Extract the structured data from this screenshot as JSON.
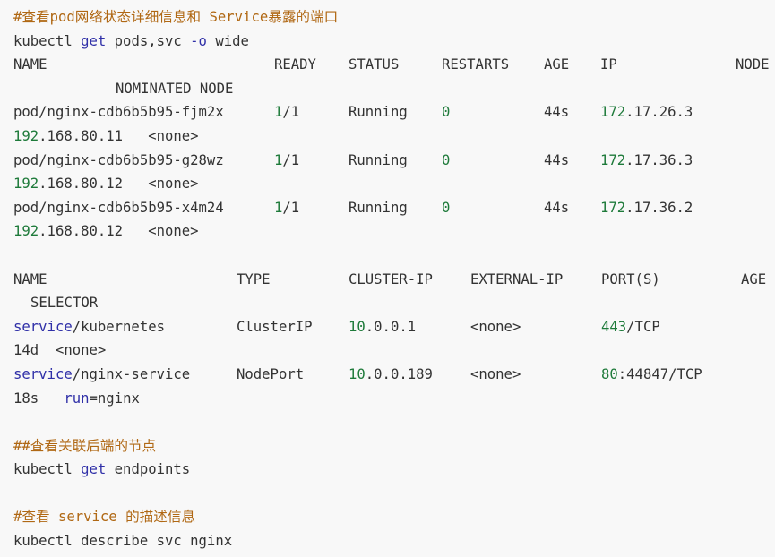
{
  "comment1": {
    "hash": "#",
    "pre": "查看",
    "pod": "pod",
    "mid": "网络状态详细信息和 ",
    "svc": "Service",
    "post": "暴露的端口"
  },
  "cmd1": {
    "a": "kubectl ",
    "get": "get",
    "b": " pods,svc ",
    "flag": "-o",
    "c": " wide"
  },
  "pods_header": {
    "name": "NAME",
    "ready": "READY",
    "status": "STATUS",
    "restarts": "RESTARTS",
    "age": "AGE",
    "ip": "IP",
    "node": "NODE",
    "nominated": "NOMINATED NODE"
  },
  "pods": [
    {
      "name": "pod/nginx-cdb6b5b95-fjm2x",
      "ready_num": "1",
      "ready_den": "/1",
      "status": "Running",
      "restarts": "0",
      "age": "44s",
      "ip_first": "172",
      "ip_rest": ".17.26.3",
      "node_first": "192",
      "node_rest": ".168.80.11",
      "nominated": "<none>"
    },
    {
      "name": "pod/nginx-cdb6b5b95-g28wz",
      "ready_num": "1",
      "ready_den": "/1",
      "status": "Running",
      "restarts": "0",
      "age": "44s",
      "ip_first": "172",
      "ip_rest": ".17.36.3",
      "node_first": "192",
      "node_rest": ".168.80.12",
      "nominated": "<none>"
    },
    {
      "name": "pod/nginx-cdb6b5b95-x4m24",
      "ready_num": "1",
      "ready_den": "/1",
      "status": "Running",
      "restarts": "0",
      "age": "44s",
      "ip_first": "172",
      "ip_rest": ".17.36.2",
      "node_first": "192",
      "node_rest": ".168.80.12",
      "nominated": "<none>"
    }
  ],
  "svc_header": {
    "name": "NAME",
    "type": "TYPE",
    "cluster_ip": "CLUSTER-IP",
    "external_ip": "EXTERNAL-IP",
    "ports": "PORT(S)",
    "age": "AGE",
    "selector": "SELECTOR"
  },
  "services": [
    {
      "kind": "service",
      "rest": "/kubernetes",
      "type": "ClusterIP",
      "cip_first": "10",
      "cip_rest": ".0.0.1",
      "external": "<none>",
      "port_num": "443",
      "port_rest": "/TCP",
      "age": "14d",
      "selector_pre": "<none>",
      "selector_key": "",
      "selector_val": ""
    },
    {
      "kind": "service",
      "rest": "/nginx-service",
      "type": "NodePort",
      "cip_first": "10",
      "cip_rest": ".0.0.189",
      "external": "<none>",
      "port_num": "80",
      "port_rest": ":44847/TCP",
      "age": "18s",
      "selector_pre": "",
      "selector_key": "run",
      "selector_val": "=nginx"
    }
  ],
  "comment2": {
    "hash": "##",
    "text": "查看关联后端的节点"
  },
  "cmd2": {
    "a": "kubectl ",
    "get": "get",
    "b": " endpoints"
  },
  "comment3": {
    "hash": "#",
    "text1": "查看 ",
    "svc": "service",
    "text2": " 的描述信息"
  },
  "cmd3": {
    "text": "kubectl describe svc nginx"
  }
}
